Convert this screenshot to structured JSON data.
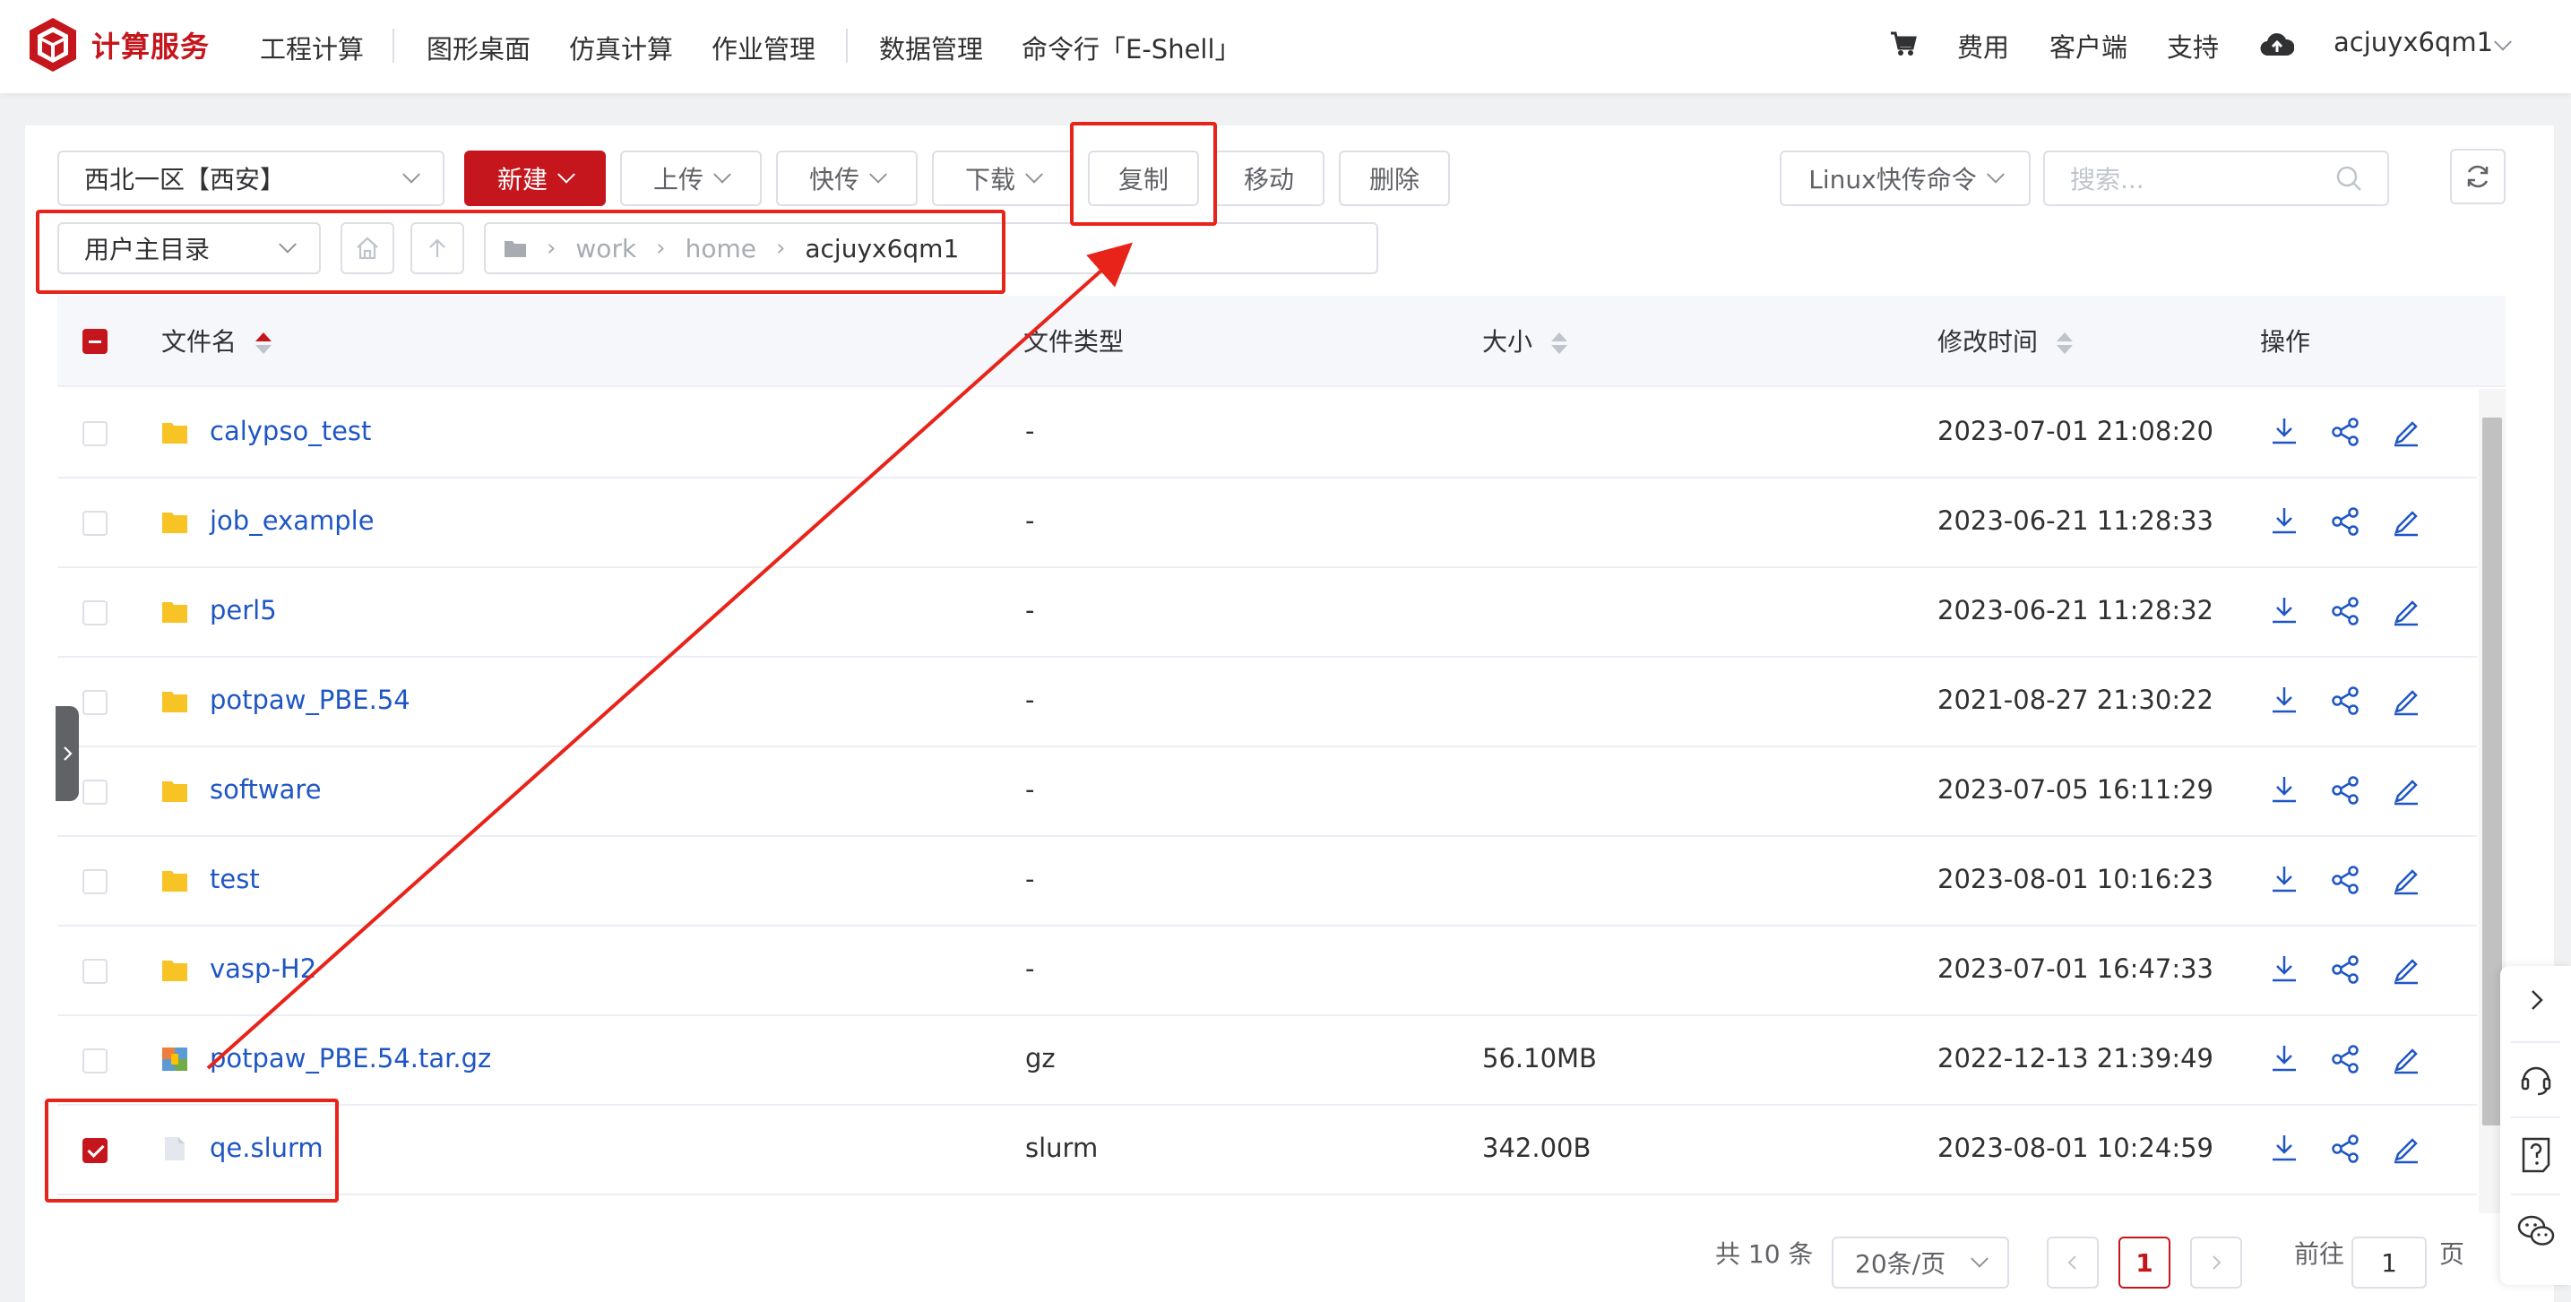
{
  "brand": {
    "name": "计算服务"
  },
  "nav": {
    "items": [
      "工程计算",
      "图形桌面",
      "仿真计算",
      "作业管理",
      "数据管理",
      "命令行「E-Shell」"
    ],
    "right": {
      "fee": "费用",
      "client": "客户端",
      "support": "支持",
      "user": "acjuyx6qm1"
    }
  },
  "toolbar": {
    "region": "西北一区【西安】",
    "new": "新建",
    "upload": "上传",
    "quick": "快传",
    "download": "下载",
    "copy": "复制",
    "move": "移动",
    "delete": "删除",
    "linux_cmd": "Linux快传命令",
    "search_placeholder": "搜索..."
  },
  "path": {
    "dir_select": "用户主目录",
    "crumbs": [
      "work",
      "home",
      "acjuyx6qm1"
    ]
  },
  "table": {
    "headers": {
      "name": "文件名",
      "type": "文件类型",
      "size": "大小",
      "mtime": "修改时间",
      "ops": "操作"
    },
    "rows": [
      {
        "name": "calypso_test",
        "type": "-",
        "size": "",
        "mtime": "2023-07-01 21:08:20",
        "kind": "folder",
        "checked": false
      },
      {
        "name": "job_example",
        "type": "-",
        "size": "",
        "mtime": "2023-06-21 11:28:33",
        "kind": "folder",
        "checked": false
      },
      {
        "name": "perl5",
        "type": "-",
        "size": "",
        "mtime": "2023-06-21 11:28:32",
        "kind": "folder",
        "checked": false
      },
      {
        "name": "potpaw_PBE.54",
        "type": "-",
        "size": "",
        "mtime": "2021-08-27 21:30:22",
        "kind": "folder",
        "checked": false
      },
      {
        "name": "software",
        "type": "-",
        "size": "",
        "mtime": "2023-07-05 16:11:29",
        "kind": "folder",
        "checked": false
      },
      {
        "name": "test",
        "type": "-",
        "size": "",
        "mtime": "2023-08-01 10:16:23",
        "kind": "folder",
        "checked": false
      },
      {
        "name": "vasp-H2",
        "type": "-",
        "size": "",
        "mtime": "2023-07-01 16:47:33",
        "kind": "folder",
        "checked": false
      },
      {
        "name": "potpaw_PBE.54.tar.gz",
        "type": "gz",
        "size": "56.10MB",
        "mtime": "2022-12-13 21:39:49",
        "kind": "archive",
        "checked": false
      },
      {
        "name": "qe.slurm",
        "type": "slurm",
        "size": "342.00B",
        "mtime": "2023-08-01 10:24:59",
        "kind": "file",
        "checked": true
      }
    ]
  },
  "pagination": {
    "total": "共 10 条",
    "page_size": "20条/页",
    "current": "1",
    "goto_label": "前往",
    "goto_value": "1",
    "page_suffix": "页"
  },
  "colors": {
    "brand": "#c4161c",
    "link": "#1f56c4",
    "annotation": "#e8231a",
    "folder": "#f7c325"
  }
}
